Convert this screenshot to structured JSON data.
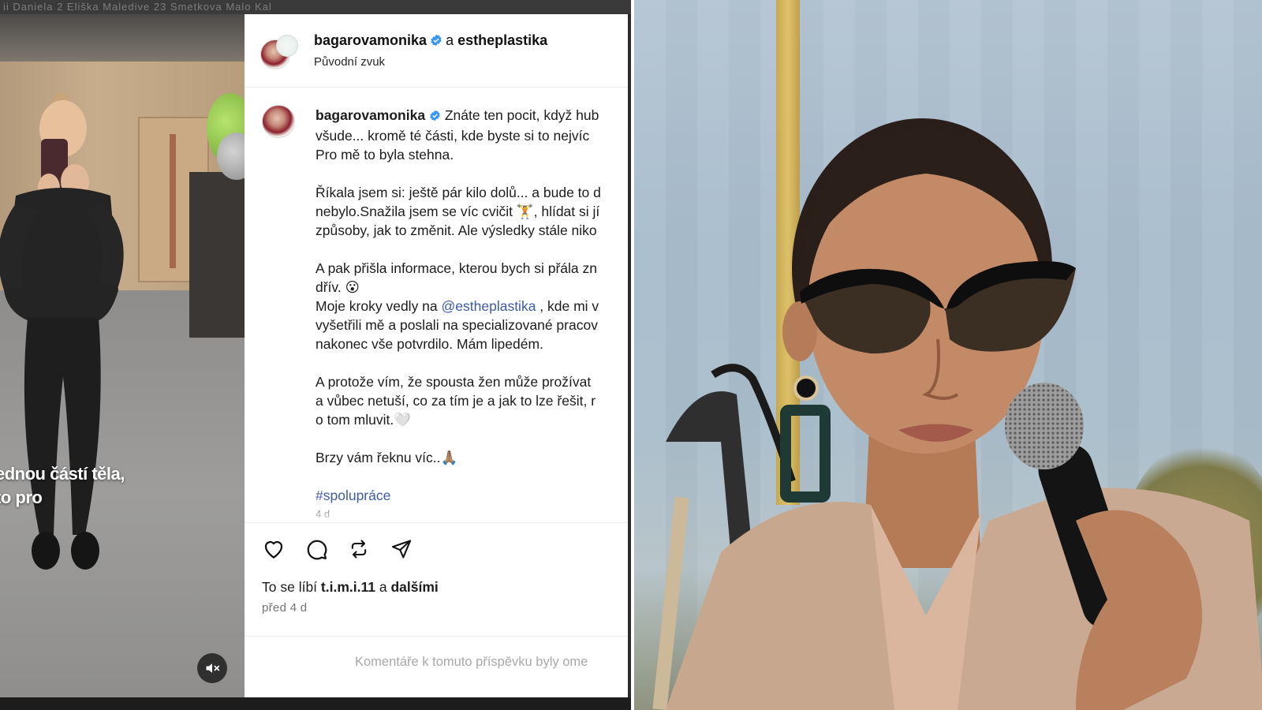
{
  "top_strip": {
    "text": "ii     Daniela 2     Eliška     Maledive 23     Smetkova     Malo     Kal"
  },
  "reel": {
    "caption_lines": [
      "ednou částí těla,",
      "to pro"
    ],
    "mute_icon": "speaker-muted-icon"
  },
  "post": {
    "header": {
      "username": "bagarovamonika",
      "connector": "a",
      "collaborator": "estheplastika",
      "audio_label": "Původní zvuk"
    },
    "caption": {
      "username": "bagarovamonika",
      "line1": "Znáte ten pocit, když hub",
      "line2": "všude... kromě té části, kde byste si to nejvíc",
      "line3": "Pro mě to byla stehna.",
      "line4": "Říkala jsem si: ještě pár kilo dolů... a bude to d",
      "line5": "nebylo.Snažila jsem se víc cvičit 🏋️, hlídat si jí",
      "line6": "způsoby, jak to změnit. Ale výsledky stále niko",
      "line7": "A pak přišla informace, kterou bych si přála zn",
      "line8": "dřív. 😮",
      "line9_pre": "Moje kroky vedly na ",
      "line9_mention": "@estheplastika",
      "line9_post": " , kde mi v",
      "line10": "vyšetřili mě a poslali na specializované pracov",
      "line11": "nakonec vše potvrdilo. Mám lipedém.",
      "line12": "A protože vím, že spousta žen může prožívat",
      "line13": "a vůbec netuší, co za tím je a jak to lze řešit, r",
      "line14": "o tom mluvit.🤍",
      "line15": "Brzy vám řeknu víc..🙏🏽",
      "hashtag": "#spolupráce",
      "partial": "4 d"
    },
    "actions": {
      "like_icon": "heart-icon",
      "comment_icon": "comment-icon",
      "repost_icon": "repost-icon",
      "share_icon": "send-icon"
    },
    "likes": {
      "prefix": "To se líbí",
      "user": "t.i.m.i.11",
      "connector": "a",
      "others": "dalšími"
    },
    "date": "před 4 d",
    "comments_notice": "Komentáře k tomuto příspěvku byly ome"
  },
  "colors": {
    "link_blue": "#3c5ba9",
    "verified_blue": "#3897f0",
    "muted_text": "#737373"
  }
}
